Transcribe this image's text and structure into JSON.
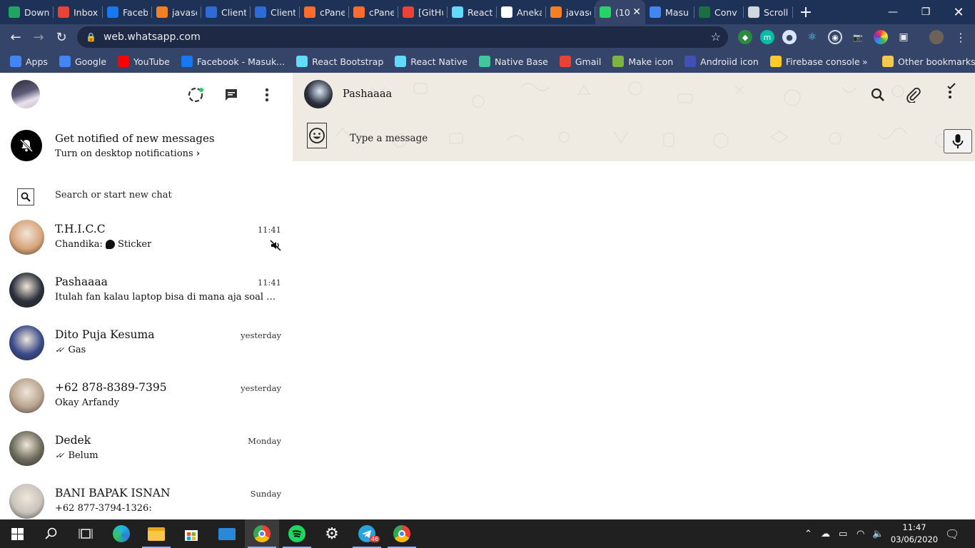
{
  "browser": {
    "tabs": [
      {
        "label": "Down",
        "icon": "google-drive-icon",
        "color": "#1fa463"
      },
      {
        "label": "Inbox",
        "icon": "gmail-icon",
        "color": "#ea4335"
      },
      {
        "label": "Faceb",
        "icon": "facebook-icon",
        "color": "#1877f2"
      },
      {
        "label": "javasc",
        "icon": "stackoverflow-icon",
        "color": "#f48024"
      },
      {
        "label": "Client",
        "icon": "window-icon",
        "color": "#2e6bd6"
      },
      {
        "label": "Client",
        "icon": "window-icon",
        "color": "#2e6bd6"
      },
      {
        "label": "cPane",
        "icon": "cpanel-icon",
        "color": "#ff6c2c"
      },
      {
        "label": "cPane",
        "icon": "cpanel-icon",
        "color": "#ff6c2c"
      },
      {
        "label": "[GitHu",
        "icon": "gmail-icon",
        "color": "#ea4335"
      },
      {
        "label": "React",
        "icon": "react-icon",
        "color": "#61dafb"
      },
      {
        "label": "Aneka",
        "icon": "github-icon",
        "color": "#ffffff"
      },
      {
        "label": "javasc",
        "icon": "stackoverflow-icon",
        "color": "#f48024"
      },
      {
        "label": "(10",
        "icon": "whatsapp-icon",
        "color": "#25d366",
        "active": true
      },
      {
        "label": "Masu",
        "icon": "google-icon",
        "color": "#4285f4"
      },
      {
        "label": "Conv",
        "icon": "excel-icon",
        "color": "#1d6f42"
      },
      {
        "label": "Scroll",
        "icon": "cloud-icon",
        "color": "#cfd8dc"
      }
    ],
    "url": "web.whatsapp.com",
    "bookmarks": [
      {
        "label": "Apps",
        "icon": "apps-grid-icon",
        "color": "#4285f4"
      },
      {
        "label": "Google",
        "icon": "google-icon",
        "color": "#4285f4"
      },
      {
        "label": "YouTube",
        "icon": "youtube-icon",
        "color": "#ff0000"
      },
      {
        "label": "Facebook - Masuk...",
        "icon": "facebook-icon",
        "color": "#1877f2"
      },
      {
        "label": "React Bootstrap",
        "icon": "react-icon",
        "color": "#61dafb"
      },
      {
        "label": "React Native",
        "icon": "react-icon",
        "color": "#61dafb"
      },
      {
        "label": "Native Base",
        "icon": "nativebase-icon",
        "color": "#43c59e"
      },
      {
        "label": "Gmail",
        "icon": "gmail-icon",
        "color": "#ea4335"
      },
      {
        "label": "Make icon",
        "icon": "image-icon",
        "color": "#7cb342"
      },
      {
        "label": "Androiid icon",
        "icon": "android-icon",
        "color": "#3f51b5"
      },
      {
        "label": "Firebase console",
        "icon": "firebase-icon",
        "color": "#ffca28"
      }
    ],
    "overflow": "»",
    "other_bookmarks": "Other bookmarks"
  },
  "sidebar": {
    "notification": {
      "title": "Get notified of new messages",
      "subtitle": "Turn on desktop notifications"
    },
    "search_placeholder": "Search or start new chat",
    "chats": [
      {
        "name": "T.H.I.C.C",
        "time": "11:41",
        "sender": "Chandika:",
        "message": "Sticker",
        "muted": true,
        "avatar": "#d8a47a"
      },
      {
        "name": "Pashaaaa",
        "time": "11:41",
        "message": "Itulah fan kalau laptop bisa di mana aja soal nya bida…",
        "avatar": "#2a2f3a"
      },
      {
        "name": "Dito Puja Kesuma",
        "time": "yesterday",
        "message": "Gas",
        "read": true,
        "avatar": "#3a4a8a"
      },
      {
        "name": "+62 878-8389-7395",
        "time": "yesterday",
        "message": "Okay Arfandy",
        "avatar": "#b9a48e"
      },
      {
        "name": "Dedek",
        "time": "Monday",
        "message": "Belum",
        "read": true,
        "avatar": "#6c6a5a"
      },
      {
        "name": " BANI BAPAK ISNAN",
        "time": "Sunday",
        "message": "+62 877-3794-1326:",
        "avatar": "#c9c3bc"
      }
    ]
  },
  "conversation": {
    "contact_name": "Pashaaaa",
    "message_placeholder": "Type a message"
  },
  "taskbar": {
    "time": "11:47",
    "date": "03/06/2020",
    "telegram_badge": "46"
  },
  "colors": {
    "chrome_tabstrip": "#1e3157",
    "chrome_toolbar": "#35456a",
    "wa_background": "#efeae2",
    "taskbar": "#202020"
  }
}
